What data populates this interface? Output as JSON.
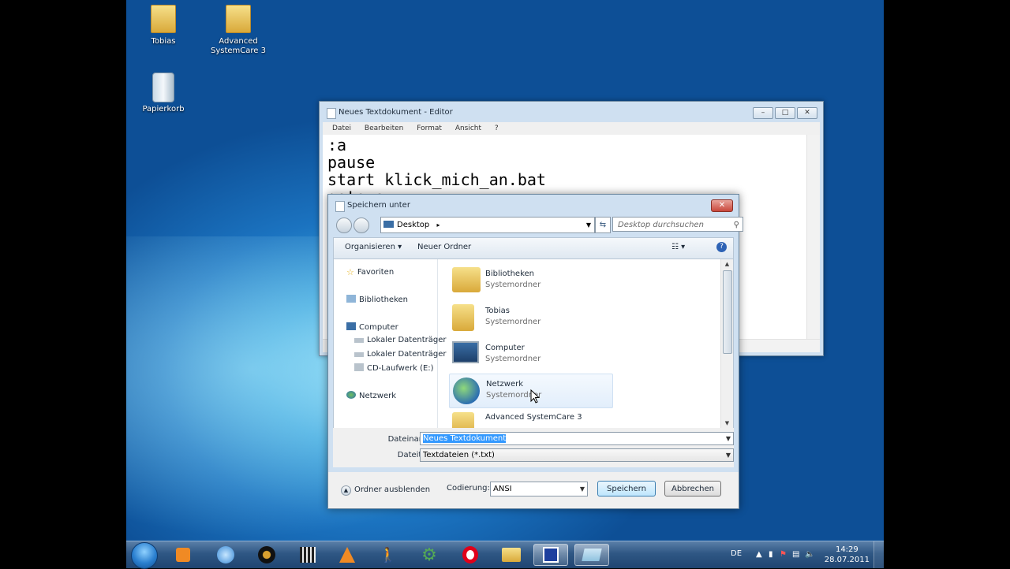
{
  "desktop": {
    "icons": [
      {
        "label": "Tobias"
      },
      {
        "label": "Advanced SystemCare 3"
      },
      {
        "label": "Papierkorb"
      }
    ]
  },
  "notepad": {
    "title": "Neues Textdokument - Editor",
    "menu": [
      "Datei",
      "Bearbeiten",
      "Format",
      "Ansicht",
      "?"
    ],
    "content": ":a\npause\nstart klick_mich_an.bat\ngoto a"
  },
  "save_dialog": {
    "title": "Speichern unter",
    "address": "Desktop",
    "search_placeholder": "Desktop durchsuchen",
    "toolbar": {
      "organize": "Organisieren",
      "new_folder": "Neuer Ordner"
    },
    "nav": {
      "favorites": "Favoriten",
      "libraries": "Bibliotheken",
      "computer": "Computer",
      "drive1": "Lokaler Datenträger",
      "drive2": "Lokaler Datenträger",
      "cd": "CD-Laufwerk (E:)",
      "network": "Netzwerk"
    },
    "files": [
      {
        "name": "Bibliotheken",
        "type": "Systemordner"
      },
      {
        "name": "Tobias",
        "type": "Systemordner"
      },
      {
        "name": "Computer",
        "type": "Systemordner"
      },
      {
        "name": "Netzwerk",
        "type": "Systemordner"
      },
      {
        "name": "Advanced SystemCare 3",
        "type": ""
      }
    ],
    "filename_label": "Dateiname:",
    "filename_value": "Neues Textdokument",
    "filetype_label": "Dateityp:",
    "filetype_value": "Textdateien (*.txt)",
    "hide_folders": "Ordner ausblenden",
    "encoding_label": "Codierung:",
    "encoding_value": "ANSI",
    "save_button": "Speichern",
    "cancel_button": "Abbrechen"
  },
  "taskbar": {
    "language": "DE",
    "time": "14:29",
    "date": "28.07.2011"
  }
}
